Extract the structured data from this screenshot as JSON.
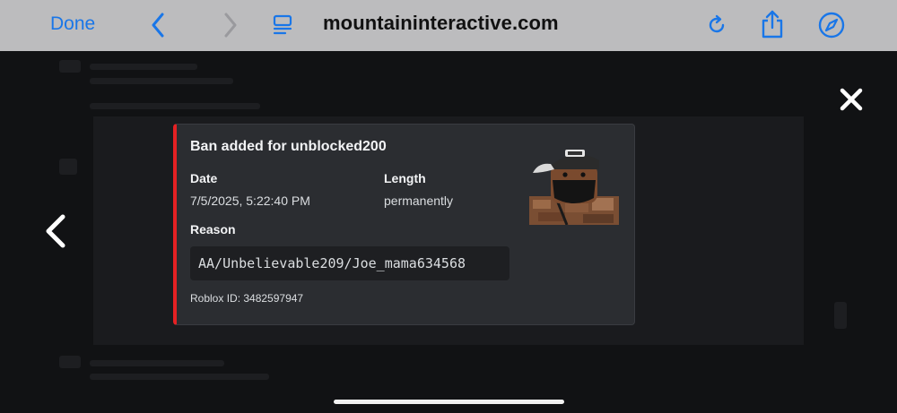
{
  "browser": {
    "done_label": "Done",
    "url": "mountaininteractive.com",
    "icons": [
      "chevron-left-icon",
      "chevron-right-icon",
      "reader-icon",
      "reload-icon",
      "share-icon",
      "compass-icon"
    ],
    "accent_color": "#1976e8"
  },
  "lightbox": {
    "close_icon": "close-icon",
    "prev_icon": "chevron-left-icon"
  },
  "embed": {
    "title": "Ban added for unblocked200",
    "accent_color": "#e52123",
    "fields": {
      "date": {
        "name": "Date",
        "value": "7/5/2025, 5:22:40 PM"
      },
      "length": {
        "name": "Length",
        "value": "permanently"
      },
      "reason": {
        "name": "Reason",
        "value": "AA/Unbelievable209/Joe_mama634568"
      }
    },
    "footer": "Roblox ID: 3482597947",
    "thumbnail": "roblox-avatar"
  }
}
